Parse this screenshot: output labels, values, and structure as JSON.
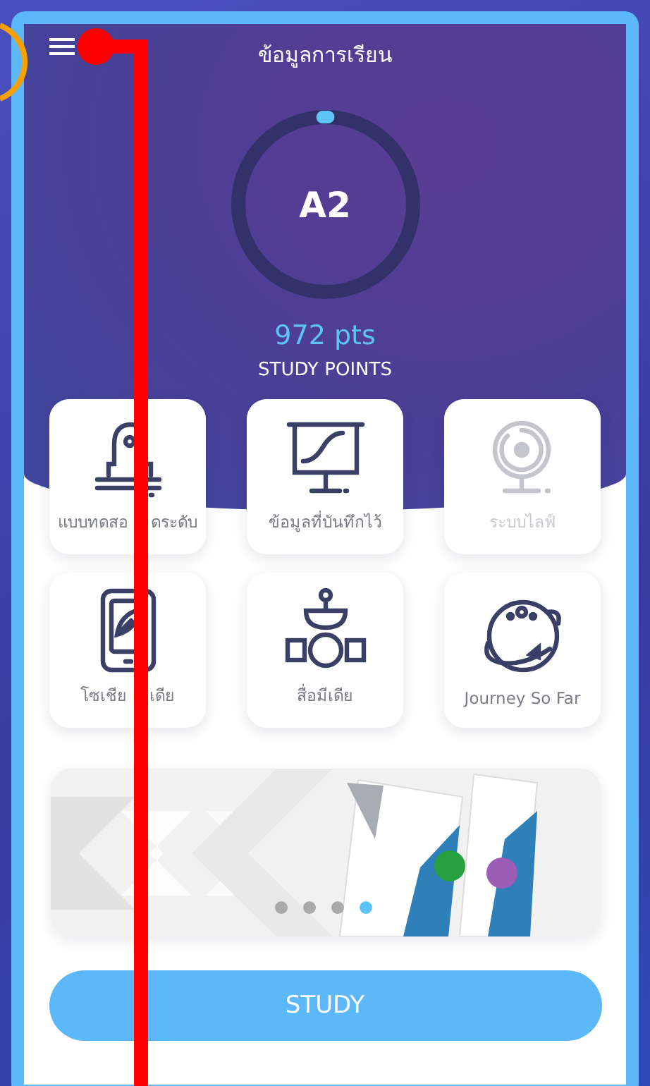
{
  "header": {
    "title": "ข้อมูลการเรียน"
  },
  "level_ring": {
    "grade": "A2",
    "level": 0.01
  },
  "points": {
    "value": "972 pts",
    "label": "STUDY POINTS"
  },
  "tiles": [
    {
      "label_parts": [
        "แบบทดสอ",
        "ดระดับ"
      ],
      "disabled": false
    },
    {
      "label": "ข้อมูลที่บันทึกไว้",
      "disabled": false
    },
    {
      "label": "ระบบไลฟ์",
      "disabled": true
    },
    {
      "label_parts": [
        "โซเชีย",
        "เดีย"
      ],
      "disabled": false
    },
    {
      "label": "สื่อมีเดีย",
      "disabled": false
    },
    {
      "label": "Journey So Far",
      "disabled": false
    }
  ],
  "carousel": {
    "kind": "picture",
    "pages": [
      {
        "selected": false
      },
      {
        "selected": false
      },
      {
        "selected": false
      },
      {
        "selected": true
      }
    ]
  },
  "study_button": {
    "label": "STUDY"
  }
}
